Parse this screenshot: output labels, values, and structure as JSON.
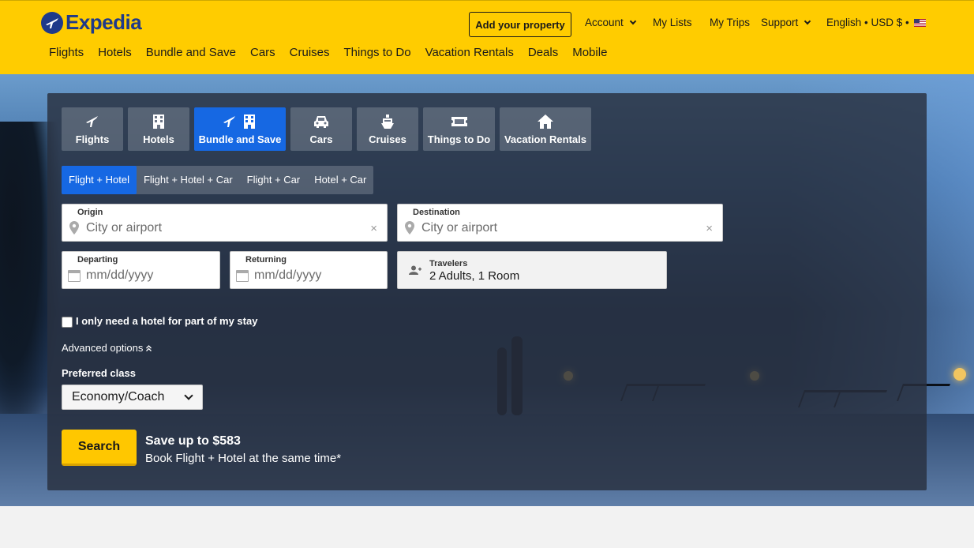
{
  "brand": {
    "name": "Expedia",
    "accent": "#ffcc00",
    "primary_blue": "#1668e3"
  },
  "header": {
    "add_property": "Add your property",
    "account": "Account",
    "my_lists": "My Lists",
    "my_trips": "My Trips",
    "support": "Support",
    "locale": "English • USD $ •",
    "locale_flag_icon": "us-flag-icon"
  },
  "main_nav": [
    "Flights",
    "Hotels",
    "Bundle and Save",
    "Cars",
    "Cruises",
    "Things to Do",
    "Vacation Rentals",
    "Deals",
    "Mobile"
  ],
  "search": {
    "tabs": [
      {
        "label": "Flights",
        "icon": "plane-icon"
      },
      {
        "label": "Hotels",
        "icon": "hotel-icon"
      },
      {
        "label": "Bundle and Save",
        "icon": "plane-hotel-icon",
        "active": true
      },
      {
        "label": "Cars",
        "icon": "car-icon"
      },
      {
        "label": "Cruises",
        "icon": "cruise-icon"
      },
      {
        "label": "Things to Do",
        "icon": "ticket-icon"
      },
      {
        "label": "Vacation Rentals",
        "icon": "house-icon"
      }
    ],
    "subtabs": [
      {
        "label": "Flight + Hotel",
        "active": true
      },
      {
        "label": "Flight + Hotel + Car"
      },
      {
        "label": "Flight + Car"
      },
      {
        "label": "Hotel + Car"
      }
    ],
    "origin": {
      "label": "Origin",
      "placeholder": "City or airport",
      "clear": "×"
    },
    "destination": {
      "label": "Destination",
      "placeholder": "City or airport",
      "clear": "×"
    },
    "departing": {
      "label": "Departing",
      "placeholder": "mm/dd/yyyy"
    },
    "returning": {
      "label": "Returning",
      "placeholder": "mm/dd/yyyy"
    },
    "travelers": {
      "label": "Travelers",
      "value": "2 Adults, 1 Room"
    },
    "hotel_part_of_stay": "I only need a hotel for part of my stay",
    "advanced_options": "Advanced options",
    "preferred_class_label": "Preferred class",
    "preferred_class_value": "Economy/Coach",
    "search_button": "Search",
    "promo_title": "Save up to $583",
    "promo_subtitle": "Book Flight + Hotel at the same time*"
  }
}
